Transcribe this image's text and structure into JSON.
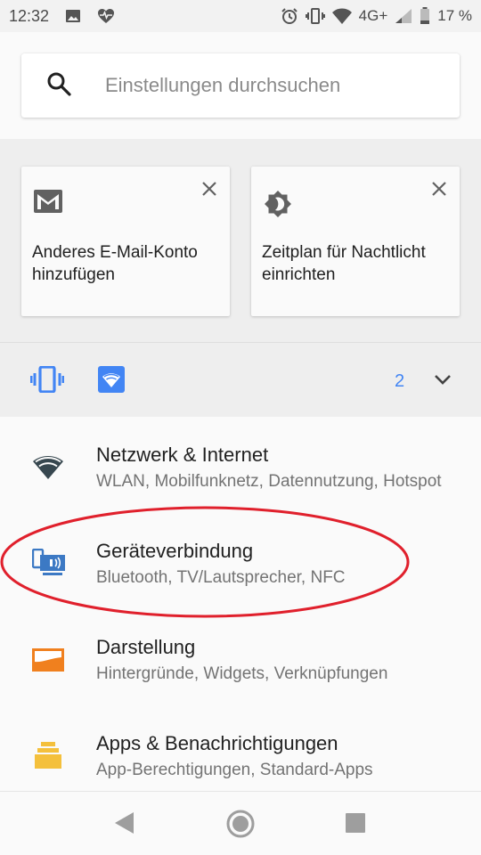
{
  "status_bar": {
    "time": "12:32",
    "network": "4G+",
    "battery": "17 %",
    "icons": [
      "image-icon",
      "heart-pulse-icon",
      "alarm-icon",
      "vibrate-icon",
      "wifi-icon",
      "signal-icon",
      "battery-icon"
    ]
  },
  "search": {
    "placeholder": "Einstellungen durchsuchen",
    "icon": "search-icon"
  },
  "suggestions": [
    {
      "icon": "gmail-icon",
      "text": "Anderes E-Mail-Konto\nhinzufügen"
    },
    {
      "icon": "night-light-icon",
      "text": "Zeitplan für Nachtlicht\neinrichten"
    }
  ],
  "conditions": {
    "icons": [
      "vibrate-icon",
      "wifi-icon"
    ],
    "count": "2",
    "expand_icon": "chevron-down-icon"
  },
  "settings": [
    {
      "icon": "wifi-icon",
      "title": "Netzwerk & Internet",
      "summary": "WLAN, Mobilfunknetz, Datennutzung, Hotspot"
    },
    {
      "icon": "device-connection-icon",
      "title": "Geräteverbindung",
      "summary": "Bluetooth, TV/Lautsprecher, NFC"
    },
    {
      "icon": "display-icon",
      "title": "Darstellung",
      "summary": "Hintergründe, Widgets, Verknüpfungen"
    },
    {
      "icon": "apps-icon",
      "title": "Apps & Benachrichtigungen",
      "summary": "App-Berechtigungen, Standard-Apps"
    }
  ],
  "colors": {
    "accent": "#4285f4",
    "annotation": "#e0202c",
    "display_icon": "#f0801e",
    "apps_icon": "#f4c03c",
    "wifi_icon": "#37474f"
  },
  "nav": {
    "icons": [
      "back-icon",
      "home-icon",
      "recents-icon"
    ]
  }
}
